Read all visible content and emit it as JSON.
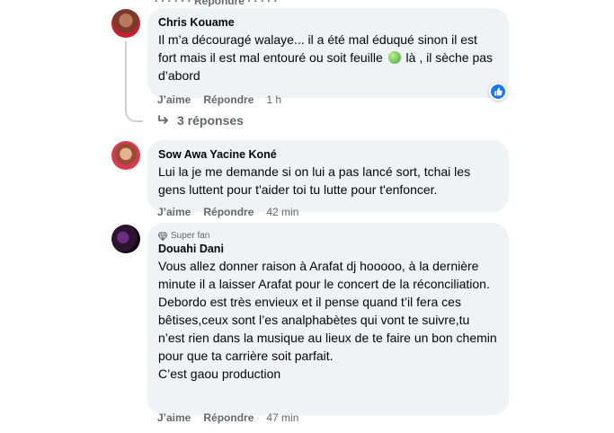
{
  "comments": [
    {
      "author": "Chris Kouame",
      "text_before_emoji": "Il m’a découragé walaye... il a été mal éduqué sinon il est fort mais il est mal entouré ou soit feuille ",
      "text_after_emoji": " là , il sèche pas d’abord",
      "emoji_icon": "leaf-emoji",
      "like_label": "J’aime",
      "reply_label": "Répondre",
      "time": "1 h",
      "reaction_icon": "like-icon",
      "reaction_color": "#1877f2",
      "replies_label": "3 réponses"
    },
    {
      "author": "Sow Awa Yacine Koné",
      "text": "Lui la je me demande si on lui a pas lancé sort, tchai les gens luttent pour t'aider toi tu lutte pour t'enfoncer.",
      "like_label": "J’aime",
      "reply_label": "Répondre",
      "time": "42 min"
    },
    {
      "author": "Douahi Dani",
      "badge": "Super fan",
      "badge_icon": "diamond-icon",
      "lines": [
        "Vous allez donner raison à Arafat dj hooooo, à la dernière minute il a laisser Arafat pour le concert de la réconciliation.",
        "Debordo est très envieux et il pense quand t’il fera ces bêtises,ceux sont l’es analphabètes qui vont te suivre,tu n’est rien dans la musique au lieux de te faire un bon chemin pour que ta carrière soit parfait.",
        "C’est gaou production"
      ],
      "like_label": "J’aime",
      "reply_label": "Répondre",
      "time": "47 min"
    }
  ]
}
